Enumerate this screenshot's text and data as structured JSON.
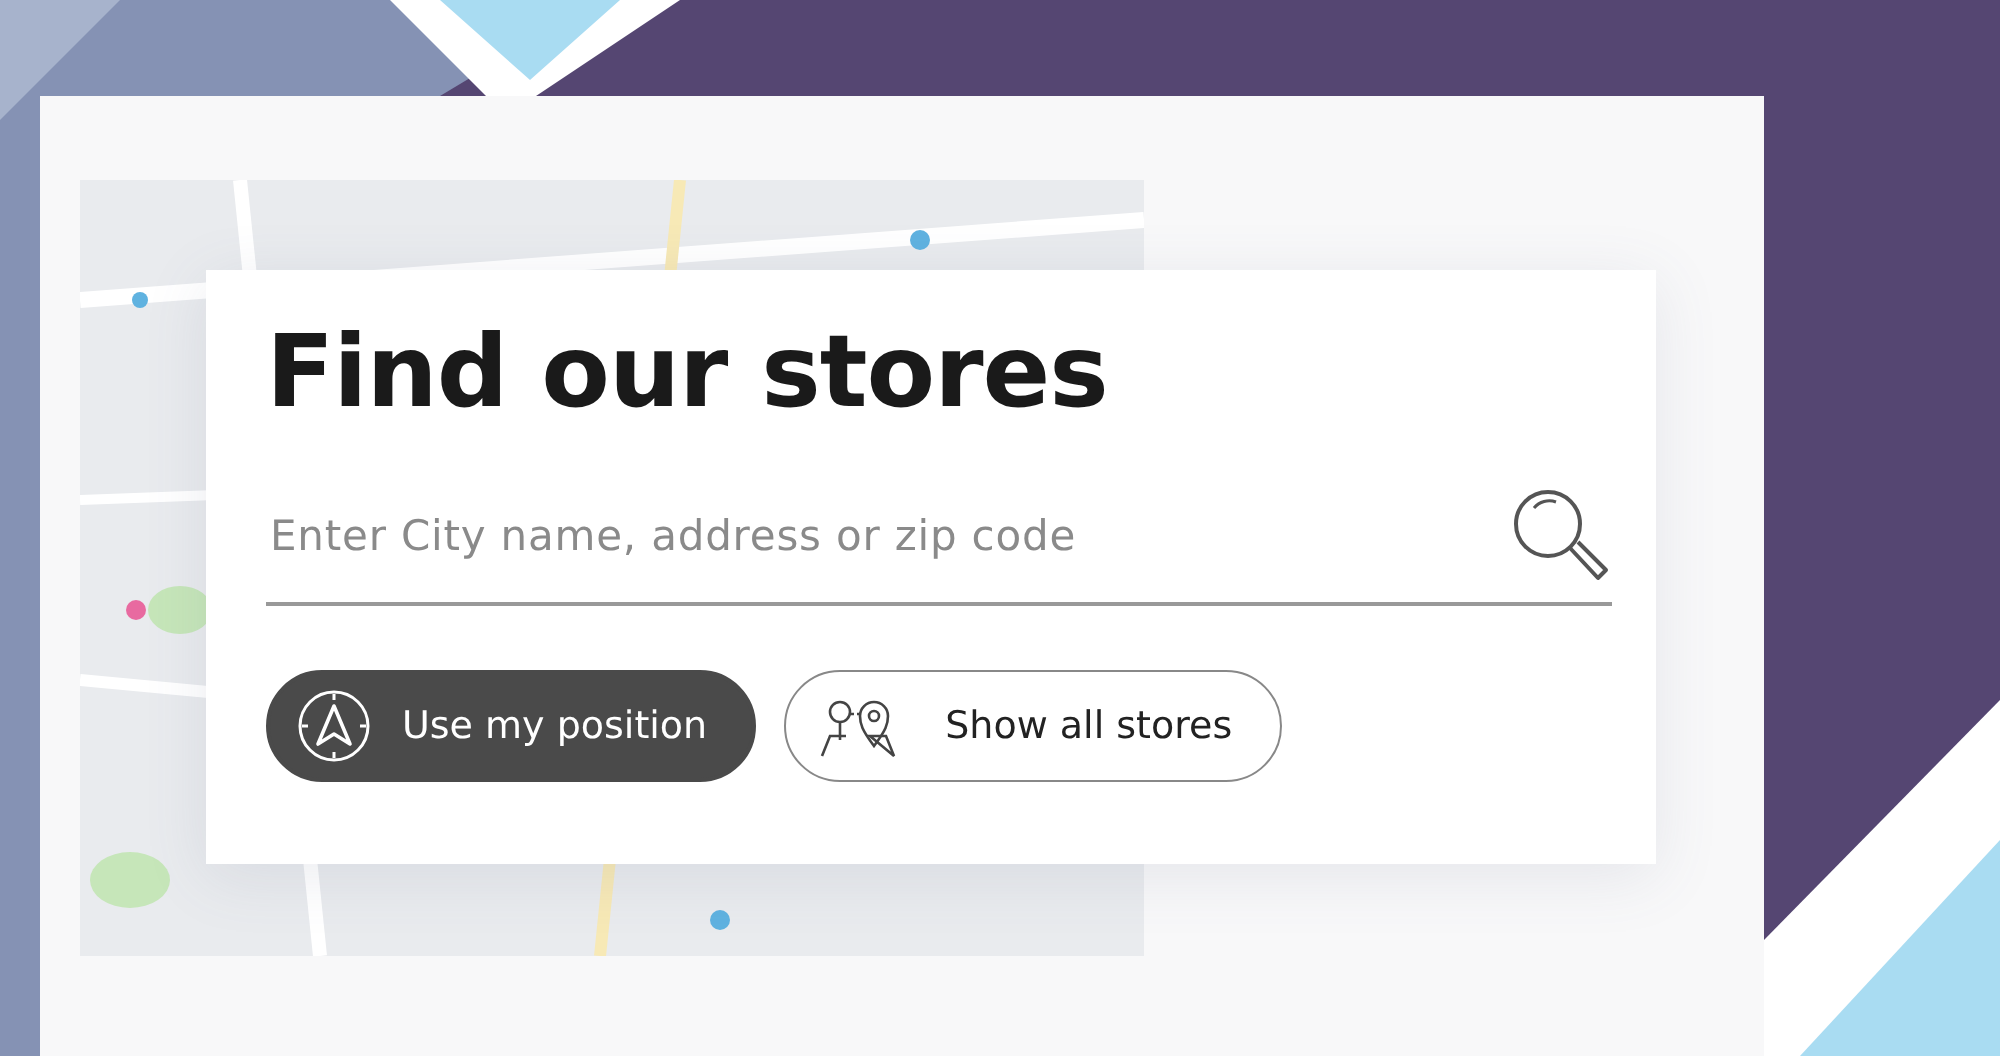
{
  "title": "Find our stores",
  "search": {
    "placeholder": "Enter City name, address or zip code"
  },
  "buttons": [
    {
      "label": "Use my position",
      "kind": "primary"
    },
    {
      "label": "Show all stores",
      "kind": "secondary"
    }
  ]
}
